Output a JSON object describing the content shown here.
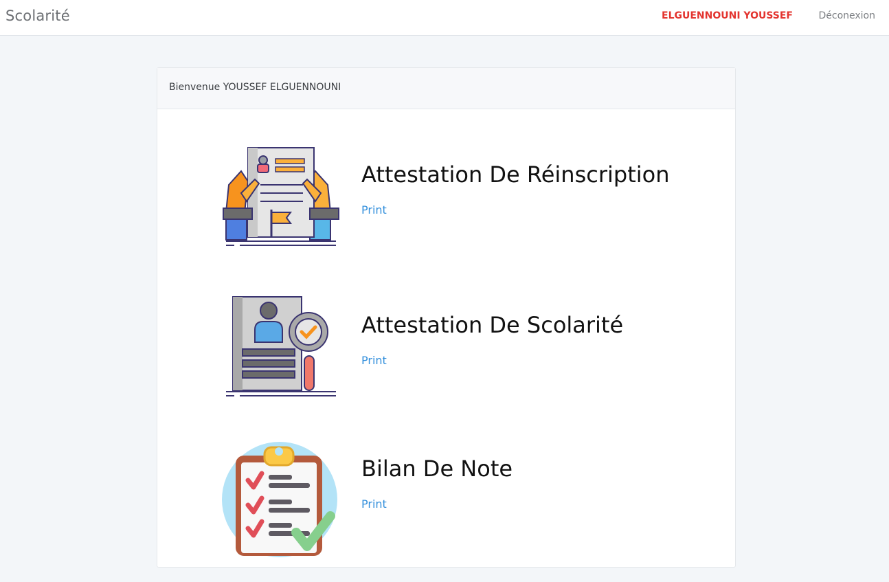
{
  "nav": {
    "brand": "Scolarité",
    "user_name": "ELGUENNOUNI YOUSSEF",
    "logout_label": "Déconexion"
  },
  "card": {
    "header": "Bienvenue YOUSSEF ELGUENNOUNI",
    "items": [
      {
        "title": "Attestation De Réinscription",
        "link_label": "Print",
        "icon": "document-hands-icon"
      },
      {
        "title": "Attestation De Scolarité",
        "link_label": "Print",
        "icon": "document-magnifier-icon"
      },
      {
        "title": "Bilan De Note",
        "link_label": "Print",
        "icon": "clipboard-check-icon"
      }
    ]
  },
  "colors": {
    "accent_red": "#e3342f",
    "link_blue": "#3490dc",
    "page_bg": "#f3f6f9"
  }
}
